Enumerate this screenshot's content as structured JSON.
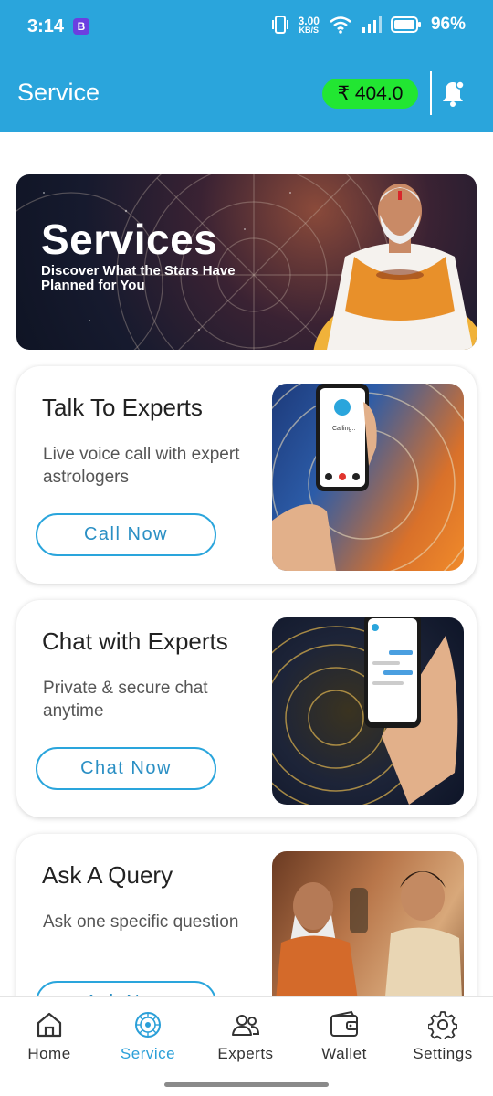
{
  "status_bar": {
    "time": "3:14",
    "app_badge": "B",
    "speed_value": "3.00",
    "speed_unit": "KB/S",
    "battery": "96%"
  },
  "app_bar": {
    "title": "Service",
    "wallet_balance": "₹ 404.0"
  },
  "banner": {
    "title": "Services",
    "subtitle": "Discover What the Stars Have Planned for You"
  },
  "cards": [
    {
      "title": "Talk To Experts",
      "description": "Live voice call with expert astrologers",
      "button_label": "Call Now",
      "image_caption": "Calling.."
    },
    {
      "title": "Chat with Experts",
      "description": "Private & secure chat anytime",
      "button_label": "Chat Now"
    },
    {
      "title": "Ask A Query",
      "description": "Ask one specific question",
      "button_label": "Ask Now"
    }
  ],
  "bottom_nav": {
    "items": [
      {
        "label": "Home",
        "icon": "home-icon",
        "active": false
      },
      {
        "label": "Service",
        "icon": "service-icon",
        "active": true
      },
      {
        "label": "Experts",
        "icon": "experts-icon",
        "active": false
      },
      {
        "label": "Wallet",
        "icon": "wallet-icon",
        "active": false
      },
      {
        "label": "Settings",
        "icon": "settings-icon",
        "active": false
      }
    ]
  },
  "colors": {
    "primary": "#2aa5dc",
    "wallet_pill": "#22e632",
    "active_nav": "#2a9fd8"
  }
}
